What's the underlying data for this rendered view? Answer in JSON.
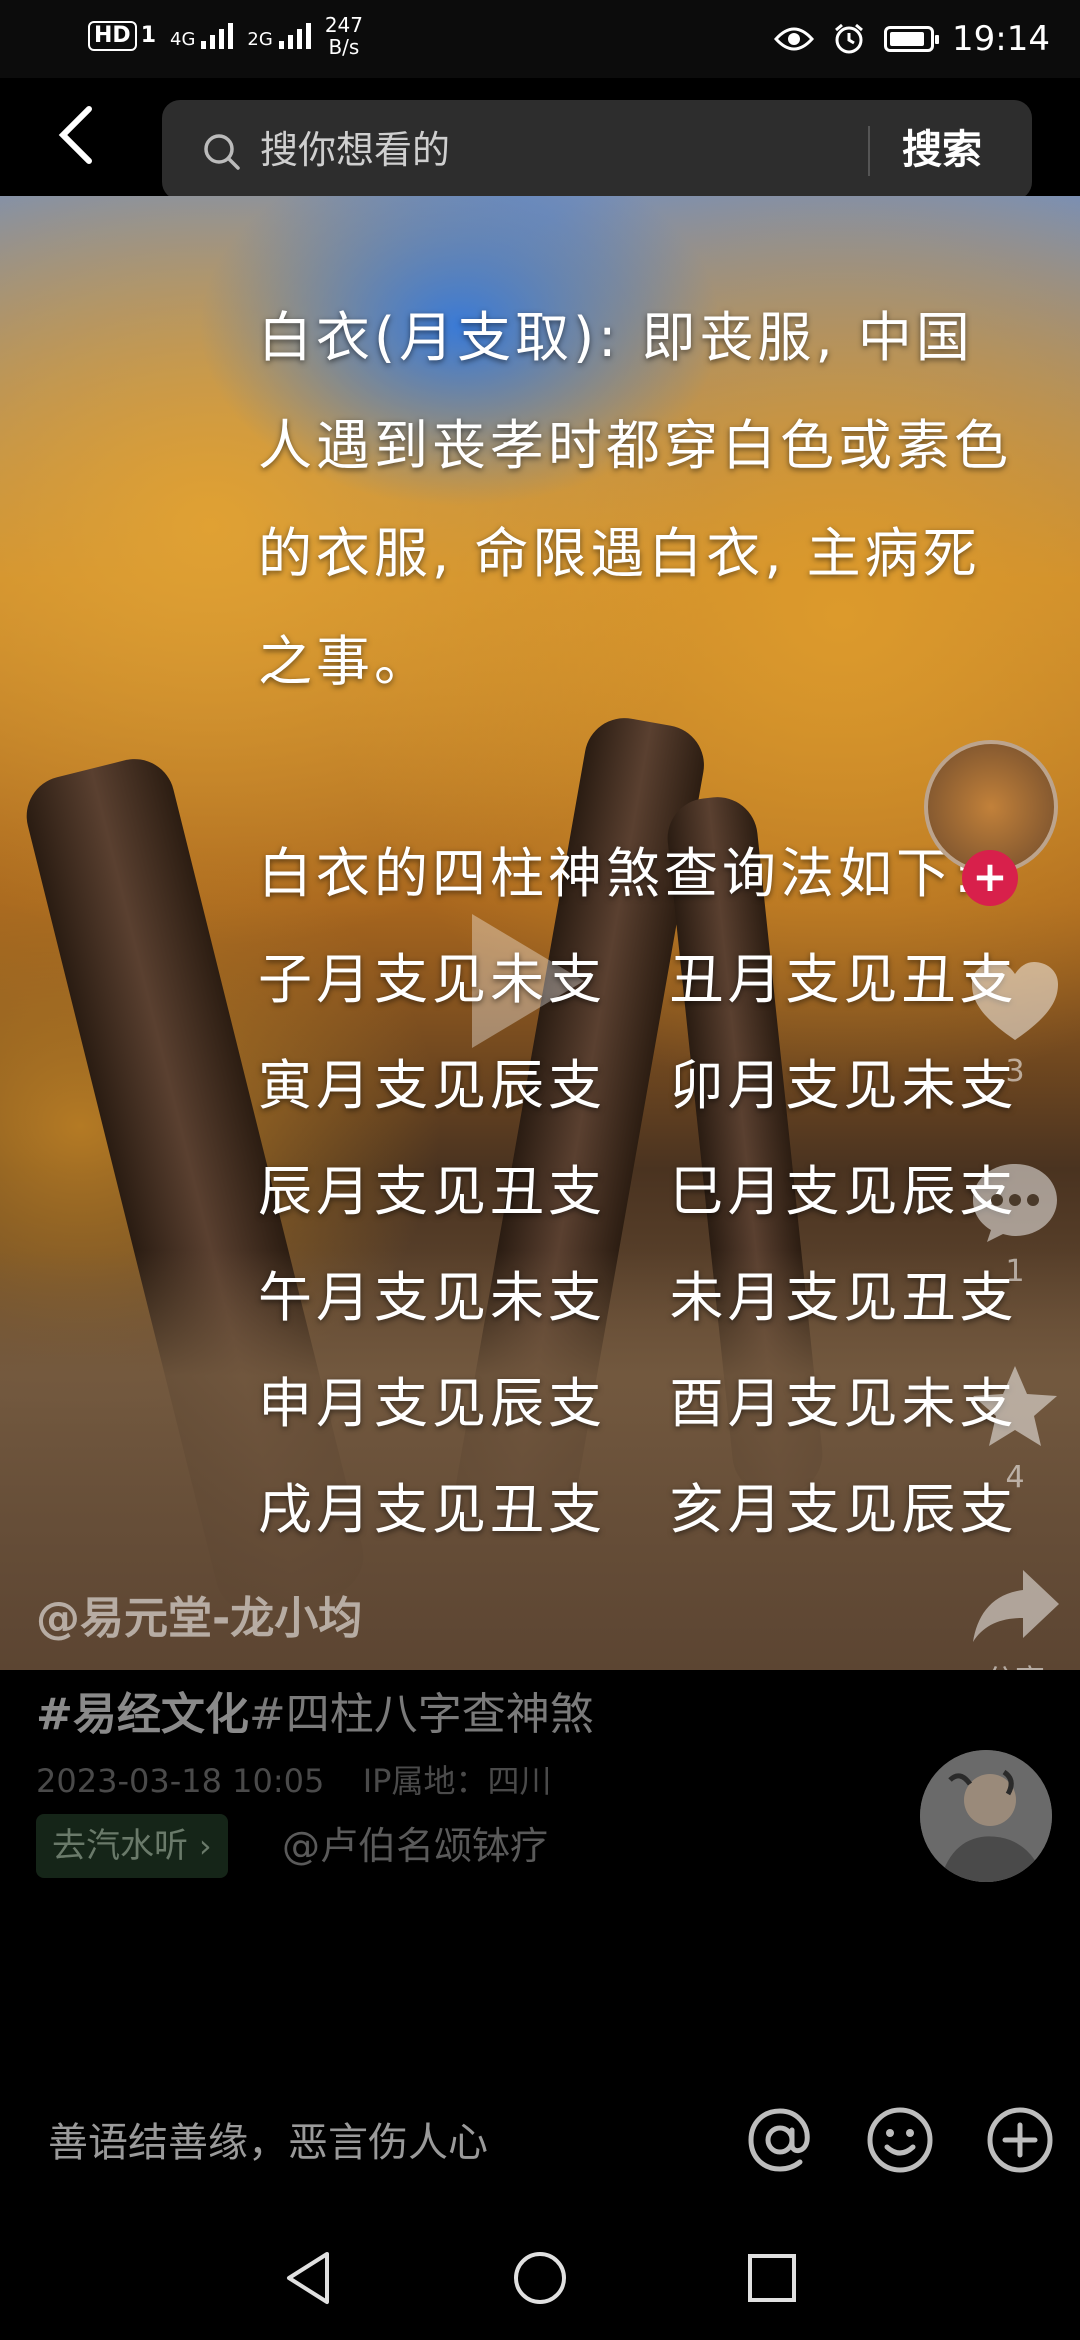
{
  "status_bar": {
    "hd": "HD",
    "sim1": "1",
    "net1": "4G",
    "net2": "2G",
    "speed_value": "247",
    "speed_unit": "B/s",
    "time": "19:14",
    "battery_level": 0.9
  },
  "search": {
    "placeholder": "搜你想看的",
    "button_label": "搜索"
  },
  "video": {
    "text_lines": [
      "白衣(月支取): 即丧服, 中国",
      "人遇到丧孝时都穿白色或素色",
      "的衣服, 命限遇白衣, 主病死",
      "之事。",
      "白衣的四柱神煞查询法如下:",
      "子月支见未支   丑月支见丑支",
      "寅月支见辰支   卯月支见未支",
      "辰月支见丑支   巳月支见辰支",
      "午月支见未支   未月支见丑支",
      "申月支见辰支   酉月支见未支",
      "戌月支见丑支   亥月支见辰支"
    ],
    "watermark": "@易元堂-龙小均"
  },
  "rail": {
    "like_count": "3",
    "comment_count": "1",
    "favorite_count": "4",
    "share_label": "分享"
  },
  "post": {
    "hashtag1": "#易经文化",
    "hashtag2": "#四柱八字查神煞",
    "date": "2023-03-18 10:05",
    "ip_location": "IP属地：四川",
    "music_chip": "去汽水听",
    "mention": "@卢伯名颂钵疗"
  },
  "comment": {
    "placeholder": "善语结善缘，恶言伤人心"
  },
  "colors": {
    "accent_red": "#d8204b",
    "search_bg": "#2d2d2d"
  }
}
